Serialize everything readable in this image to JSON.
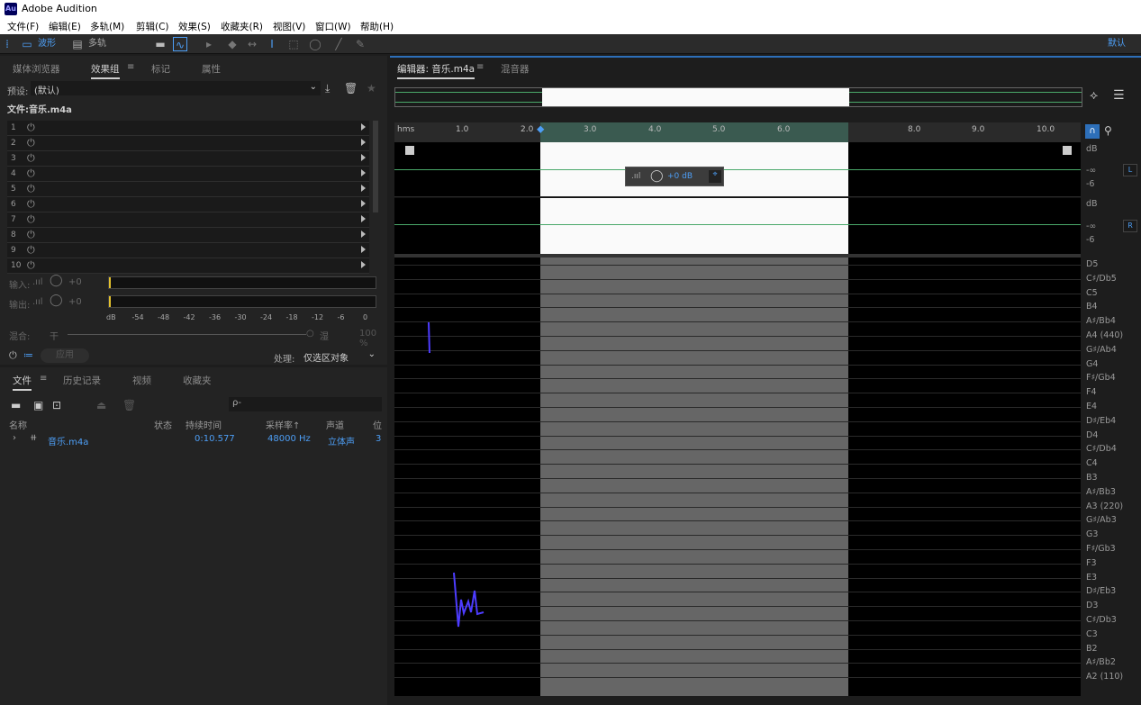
{
  "app": {
    "icon_text": "Au",
    "title": "Adobe Audition"
  },
  "menu": [
    "文件(F)",
    "编辑(E)",
    "多轨(M)",
    "剪辑(C)",
    "效果(S)",
    "收藏夹(R)",
    "视图(V)",
    "窗口(W)",
    "帮助(H)"
  ],
  "toolbar": {
    "waveform": "波形",
    "multitrack": "多轨",
    "workspace": "默认"
  },
  "effects_panel": {
    "tabs": [
      "媒体浏览器",
      "效果组",
      "标记",
      "属性"
    ],
    "active_tab": "效果组",
    "preset_label": "预设:",
    "preset_value": "(默认)",
    "file_label": "文件:音乐.m4a",
    "slots": [
      "1",
      "2",
      "3",
      "4",
      "5",
      "6",
      "7",
      "8",
      "9",
      "10"
    ],
    "input_label": "输入:",
    "output_label": "输出:",
    "input_value": "+0",
    "output_value": "+0",
    "meter_scale": [
      "dB",
      "-54",
      "-48",
      "-42",
      "-36",
      "-30",
      "-24",
      "-18",
      "-12",
      "-6",
      "0"
    ],
    "mix_label": "混合:",
    "mix_dry": "干",
    "mix_wet": "湿",
    "mix_value": "100 %",
    "apply_label": "应用",
    "process_label": "处理:",
    "process_value": "仅选区对象"
  },
  "files_panel": {
    "tabs": [
      "文件",
      "历史记录",
      "视频",
      "收藏夹"
    ],
    "search_placeholder": "ρ-",
    "columns": [
      "名称",
      "状态",
      "持续时间",
      "采样率↑",
      "声道",
      "位"
    ],
    "rows": [
      {
        "name": "音乐.m4a",
        "duration": "0:10.577",
        "sample_rate": "48000 Hz",
        "channels": "立体声",
        "bits": "3"
      }
    ]
  },
  "editor": {
    "tabs": [
      "编辑器: 音乐.m4a",
      "混音器"
    ],
    "ruler_unit": "hms",
    "ruler_labels": [
      "1.0",
      "2.0",
      "3.0",
      "4.0",
      "5.0",
      "6.0",
      "8.0",
      "9.0",
      "10.0"
    ],
    "hud_gain": "+0 dB",
    "db_labels": [
      "dB",
      "-∞",
      "-6",
      "dB",
      "-∞",
      "-6"
    ],
    "channels": [
      "L",
      "R"
    ],
    "notes": [
      "D5",
      "C♯/Db5",
      "C5",
      "B4",
      "A♯/Bb4",
      "A4 (440)",
      "G♯/Ab4",
      "G4",
      "F♯/Gb4",
      "F4",
      "E4",
      "D♯/Eb4",
      "D4",
      "C♯/Db4",
      "C4",
      "B3",
      "A♯/Bb3",
      "A3 (220)",
      "G♯/Ab3",
      "G3",
      "F♯/Gb3",
      "F3",
      "E3",
      "D♯/Eb3",
      "D3",
      "C♯/Db3",
      "C3",
      "B2",
      "A♯/Bb2",
      "A2 (110)"
    ]
  },
  "colors": {
    "accent": "#4d9ef5",
    "selection": "#fafafa",
    "waveform": "#4aa86a",
    "pitch": "#4d3cff"
  }
}
